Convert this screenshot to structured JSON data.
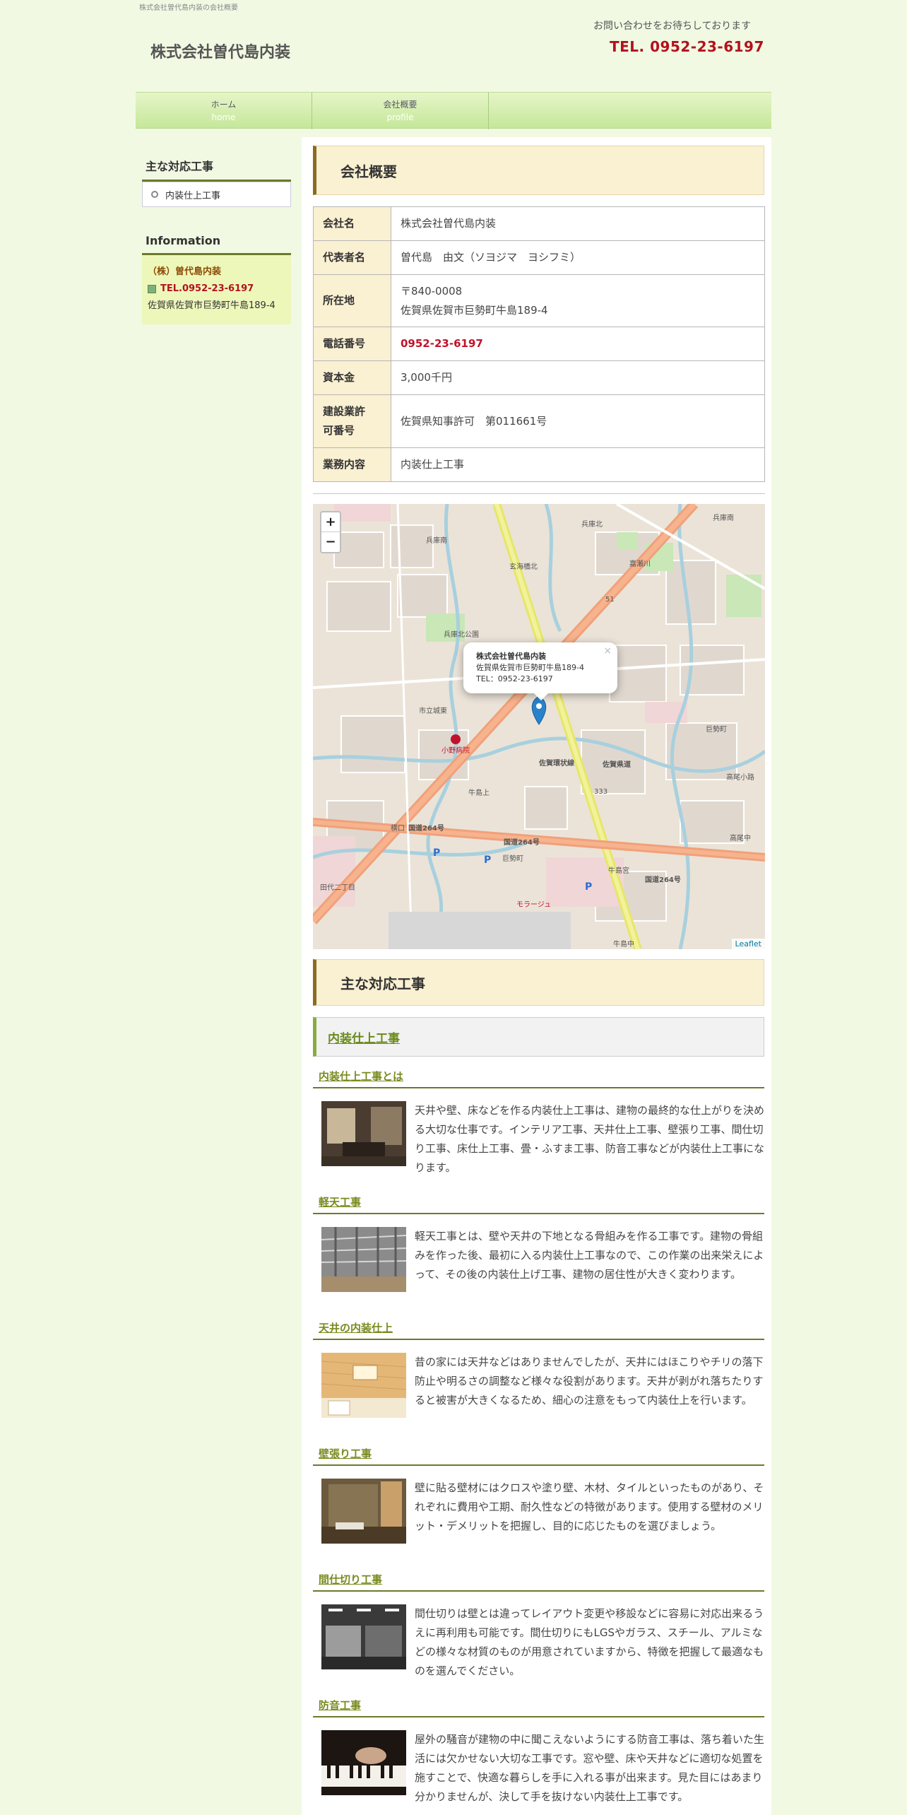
{
  "header": {
    "tiny_caption": "株式会社曽代島内装の会社概要",
    "site_title": "株式会社曽代島内装",
    "contact_note": "お問い合わせをお待ちしております",
    "contact_tel": "TEL. 0952-23-6197"
  },
  "nav": [
    {
      "ja": "ホーム",
      "en": "home"
    },
    {
      "ja": "会社概要",
      "en": "profile"
    }
  ],
  "sidebar": {
    "works_title": "主な対応工事",
    "works_link": "内装仕上工事",
    "info_title": "Information",
    "info_name": "（株）曽代島内装",
    "info_tel": "TEL.0952-23-6197",
    "info_address": "佐賀県佐賀市巨勢町牛島189-4"
  },
  "main": {
    "profile_title": "会社概要",
    "rows": [
      {
        "key": "会社名",
        "val": "株式会社曽代島内装"
      },
      {
        "key": "代表者名",
        "val": "曽代島　由文（ソヨジマ　ヨシフミ）"
      },
      {
        "key": "所在地",
        "val": "〒840-0008",
        "val2": "佐賀県佐賀市巨勢町牛島189-4"
      },
      {
        "key": "電話番号",
        "val": "0952-23-6197"
      },
      {
        "key": "資本金",
        "val": "3,000千円"
      },
      {
        "key": "建設業許",
        "key2": "可番号",
        "val": "佐賀県知事許可　第011661号"
      },
      {
        "key": "業務内容",
        "val": "内装仕上工事"
      }
    ],
    "map": {
      "zoom_in": "+",
      "zoom_out": "−",
      "popup_name": "株式会社曽代島内装",
      "popup_address": "佐賀県佐賀市巨勢町牛島189-4",
      "popup_tel": "TEL：0952-23-6197",
      "popup_close": "×",
      "attribution": "Leaflet",
      "labels": [
        "兵庫南",
        "兵庫北",
        "兵庫南",
        "嘉瀬川",
        "玄海橋北",
        "兵庫北公園",
        "市立城東",
        "小野病院",
        "佐賀環状線",
        "佐賀県道",
        "牛島上",
        "巨勢町",
        "国道264号",
        "国道264号",
        "国道264号",
        "横口",
        "牛島中",
        "田代二丁目",
        "モラージュ",
        "高尾中",
        "高尾小路",
        "巨勢町",
        "牛島宮",
        "51",
        "333"
      ]
    },
    "works_title": "主な対応工事",
    "works_sub": "内装仕上工事",
    "items": [
      {
        "title": "内装仕上工事とは",
        "text": "天井や壁、床などを作る内装仕上工事は、建物の最終的な仕上がりを決める大切な仕事です。インテリア工事、天井仕上工事、壁張り工事、間仕切り工事、床仕上工事、畳・ふすま工事、防音工事などが内装仕上工事になります。"
      },
      {
        "title": "軽天工事",
        "text": "軽天工事とは、壁や天井の下地となる骨組みを作る工事です。建物の骨組みを作った後、最初に入る内装仕上工事なので、この作業の出来栄えによって、その後の内装仕上げ工事、建物の居住性が大きく変わります。"
      },
      {
        "title": "天井の内装仕上",
        "text": "昔の家には天井などはありませんでしたが、天井にはほこりやチリの落下防止や明るさの調整など様々な役割があります。天井が剥がれ落ちたりすると被害が大きくなるため、細心の注意をもって内装仕上を行います。"
      },
      {
        "title": "壁張り工事",
        "text": "壁に貼る壁材にはクロスや塗り壁、木材、タイルといったものがあり、それぞれに費用や工期、耐久性などの特徴があります。使用する壁材のメリット・デメリットを把握し、目的に応じたものを選びましょう。"
      },
      {
        "title": "間仕切り工事",
        "text": "間仕切りは壁とは違ってレイアウト変更や移設などに容易に対応出来るうえに再利用も可能です。間仕切りにもLGSやガラス、スチール、アルミなどの様々な材質のものが用意されていますから、特徴を把握して最適なものを選んでください。"
      },
      {
        "title": "防音工事",
        "text": "屋外の騒音が建物の中に聞こえないようにする防音工事は、落ち着いた生活には欠かせない大切な工事です。窓や壁、床や天井などに適切な処置を施すことで、快適な暮らしを手に入れる事が出来ます。見た目にはあまり分かりませんが、決して手を抜けない内装仕上工事です。"
      }
    ]
  }
}
